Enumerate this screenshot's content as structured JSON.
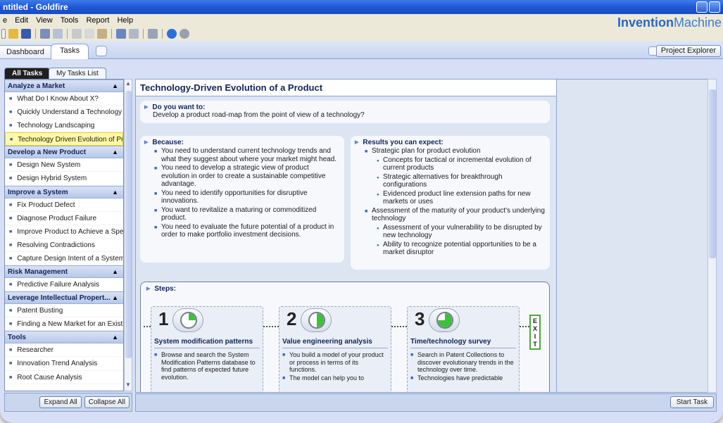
{
  "window": {
    "title": "ntitled - Goldfire"
  },
  "brand": {
    "bold": "Invention",
    "rest": "Machine"
  },
  "menu": [
    "e",
    "Edit",
    "View",
    "Tools",
    "Report",
    "Help"
  ],
  "colors": {
    "accent": "#1d55d3",
    "selected": "#fff9a6",
    "exit_border": "#4ca83b"
  },
  "main_tabs": [
    {
      "label": "Dashboard"
    },
    {
      "label": "Tasks"
    }
  ],
  "project_explorer_label": "Project Explorer",
  "left_tabs": [
    {
      "label": "All Tasks"
    },
    {
      "label": "My Tasks List"
    }
  ],
  "task_sections": [
    {
      "title": "Analyze a Market",
      "items": [
        "What Do I Know About X?",
        "Quickly Understand a Technology",
        "Technology Landscaping",
        "Technology Driven Evolution of Pr..."
      ]
    },
    {
      "title": "Develop a New Product",
      "items": [
        "Design New System",
        "Design Hybrid System"
      ]
    },
    {
      "title": "Improve a System",
      "items": [
        "Fix Product Defect",
        "Diagnose Product Failure",
        "Improve Product to Achieve a Spe...",
        "Resolving Contradictions",
        "Capture Design Intent of a System"
      ]
    },
    {
      "title": "Risk Management",
      "items": [
        "Predictive Failure Analysis"
      ]
    },
    {
      "title": "Leverage Intellectual Propert...",
      "items": [
        "Patent Busting",
        "Finding a New Market for an Existi..."
      ]
    },
    {
      "title": "Tools",
      "items": [
        "Researcher",
        "Innovation Trend Analysis",
        "Root Cause Analysis"
      ]
    }
  ],
  "left_buttons": {
    "expand": "Expand All",
    "collapse": "Collapse All"
  },
  "content": {
    "title": "Technology-Driven Evolution of a Product",
    "want": {
      "heading": "Do you want to:",
      "text": "Develop a product road-map from the point of view of a technology?"
    },
    "because": {
      "heading": "Because:",
      "items": [
        "You need to understand current technology trends and what they suggest about where your market might head.",
        "You need to develop a strategic view of product evolution in order to create a sustainable competitive advantage.",
        "You need to identify opportunities for disruptive innovations.",
        "You want to revitalize a maturing or commoditized product.",
        "You need to evaluate the future potential of a product in order to make portfolio investment decisions."
      ]
    },
    "results": {
      "heading": "Results you can expect:",
      "items": [
        {
          "text": "Strategic plan for product evolution",
          "sub": [
            "Concepts for tactical or incremental evolution of current products",
            "Strategic alternatives for breakthrough configurations",
            "Evidenced product line extension paths for new markets or uses"
          ]
        },
        {
          "text": "Assessment of the maturity of your product's underlying technology",
          "sub": [
            "Assessment of your vulnerability to be disrupted by new technology",
            "Ability to recognize potential opportunities to be a market disruptor"
          ]
        }
      ]
    },
    "steps": {
      "heading": "Steps:",
      "list": [
        {
          "num": "1",
          "title": "System modification patterns",
          "bullets": [
            "Browse and search the System Modification Patterns database to find patterns of expected future evolution."
          ],
          "progress": 0.25
        },
        {
          "num": "2",
          "title": "Value engineering analysis",
          "bullets": [
            "You build a model of your product or process in terms of its functions.",
            "The model can help you to"
          ],
          "progress": 0.5
        },
        {
          "num": "3",
          "title": "Time/technology survey",
          "bullets": [
            "Search in Patent Collections to discover evolutionary trends in the technology over time.",
            "Technologies have predictable"
          ],
          "progress": 0.75
        }
      ],
      "exit_letters": [
        "E",
        "X",
        "I",
        "T"
      ]
    }
  },
  "start_task": {
    "label": "Start Task"
  }
}
